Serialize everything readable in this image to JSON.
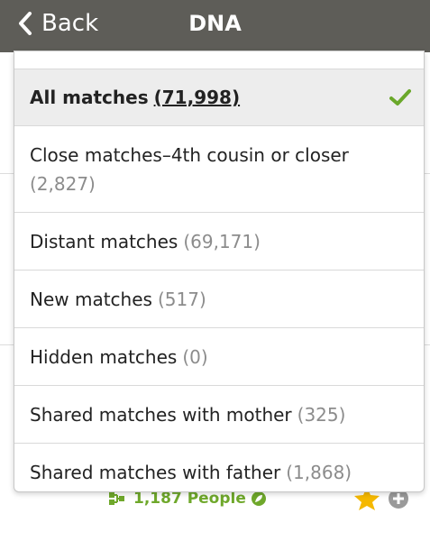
{
  "navbar": {
    "back_label": "Back",
    "title": "DNA"
  },
  "background": {
    "people_label": "1,187 People"
  },
  "filter_menu": {
    "items": [
      {
        "label": "All matches",
        "count": "(71,998)",
        "selected": true
      },
      {
        "label": "Close matches–4th cousin or closer",
        "count": "(2,827)",
        "selected": false
      },
      {
        "label": "Distant matches",
        "count": "(69,171)",
        "selected": false
      },
      {
        "label": "New matches",
        "count": "(517)",
        "selected": false
      },
      {
        "label": "Hidden matches",
        "count": "(0)",
        "selected": false
      },
      {
        "label": "Shared matches with mother",
        "count": "(325)",
        "selected": false
      },
      {
        "label": "Shared matches with father",
        "count": "(1,868)",
        "selected": false
      }
    ]
  },
  "colors": {
    "navbar_bg": "#5e5d58",
    "selected_bg": "#ededed",
    "check_green": "#6aa82a",
    "count_gray": "#8c8c8c",
    "people_green": "#6fa82b",
    "star_gold": "#f5b800"
  },
  "icons": {
    "back": "chevron-left-icon",
    "check": "checkmark-icon",
    "tree": "family-tree-icon",
    "leaf": "leaf-icon",
    "star": "star-icon",
    "plus": "plus-circle-icon"
  }
}
